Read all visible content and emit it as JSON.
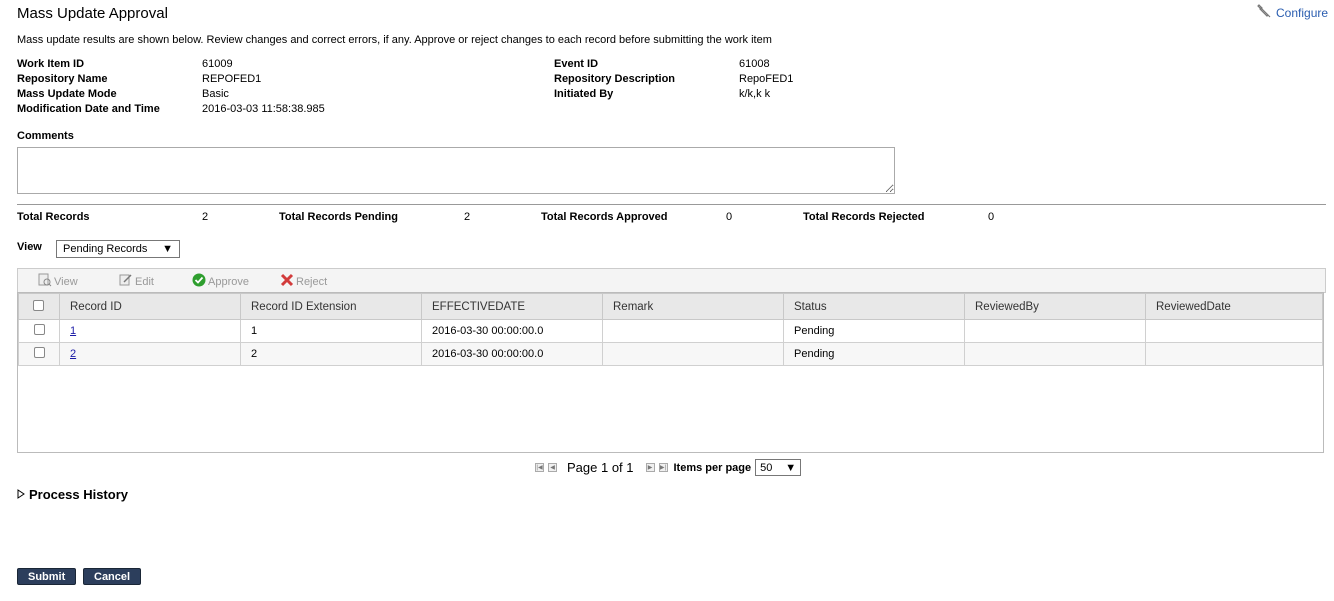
{
  "page": {
    "title": "Mass Update Approval",
    "configure_label": "Configure",
    "intro": "Mass update results are shown below. Review changes and correct errors, if any. Approve or reject changes to each record before submitting the work item"
  },
  "info_left": [
    {
      "label": "Work Item ID",
      "value": "61009"
    },
    {
      "label": "Repository Name",
      "value": "REPOFED1"
    },
    {
      "label": "Mass Update Mode",
      "value": "Basic"
    },
    {
      "label": "Modification Date and Time",
      "value": "2016-03-03 11:58:38.985"
    }
  ],
  "info_right": [
    {
      "label": "Event ID",
      "value": "61008"
    },
    {
      "label": "Repository Description",
      "value": "RepoFED1"
    },
    {
      "label": "Initiated By",
      "value": "k/k,k k"
    }
  ],
  "comments": {
    "label": "Comments",
    "value": ""
  },
  "totals": [
    {
      "label": "Total Records",
      "value": "2"
    },
    {
      "label": "Total Records Pending",
      "value": "2"
    },
    {
      "label": "Total Records Approved",
      "value": "0"
    },
    {
      "label": "Total Records Rejected",
      "value": "0"
    }
  ],
  "view": {
    "label": "View",
    "selected": "Pending Records"
  },
  "toolbar": {
    "view": "View",
    "edit": "Edit",
    "approve": "Approve",
    "reject": "Reject"
  },
  "table": {
    "columns": [
      "Record ID",
      "Record ID Extension",
      "EFFECTIVEDATE",
      "Remark",
      "Status",
      "ReviewedBy",
      "ReviewedDate"
    ],
    "rows": [
      {
        "record_id": "1",
        "extension": "1",
        "effective_date": "2016-03-30 00:00:00.0",
        "remark": "",
        "status": "Pending",
        "reviewed_by": "",
        "reviewed_date": ""
      },
      {
        "record_id": "2",
        "extension": "2",
        "effective_date": "2016-03-30 00:00:00.0",
        "remark": "",
        "status": "Pending",
        "reviewed_by": "",
        "reviewed_date": ""
      }
    ]
  },
  "pager": {
    "page_text": "Page 1 of 1",
    "items_per_page_label": "Items per page",
    "items_per_page": "50"
  },
  "process_history": "Process History",
  "buttons": {
    "submit": "Submit",
    "cancel": "Cancel"
  },
  "colors": {
    "button_bg": "#2c3e5c",
    "link": "#1a1aa6",
    "approve_icon": "#2e9e2e",
    "reject_icon": "#d23b3b"
  }
}
